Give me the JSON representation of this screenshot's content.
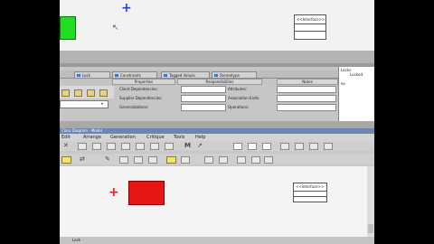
{
  "top_diagram": {
    "interface_label": "<<Interface>>",
    "plus_glyph": "+",
    "cursor_glyph": "↖"
  },
  "property_tabs": {
    "tabs": [
      "Lock",
      "Constraints",
      "Tagged Values",
      "Stereotype"
    ]
  },
  "property_subtabs": [
    "Properties",
    "Responsibilities",
    "Notes"
  ],
  "properties": {
    "left_labels": [
      "Client Dependencies:",
      "Supplier Dependencies:",
      "Generalizations:"
    ],
    "right_labels": [
      "Attributes:",
      "Association Ends:",
      "Operations:"
    ],
    "dropdown_glyph": "▾"
  },
  "locks_panel": {
    "header": "Locks",
    "column": "Locked",
    "item": "ex"
  },
  "lower_window": {
    "title": "Class Diagram - Model",
    "menus": [
      "Edit",
      "Arrange",
      "Generation",
      "Critique",
      "Tools",
      "Help"
    ],
    "toolbar_glyphs": [
      "✕",
      "⇄",
      "✎",
      "M",
      "↗"
    ],
    "status_text": "Lock"
  },
  "bottom_diagram": {
    "interface_label": "<<Interface>>",
    "plus_glyph": "+"
  },
  "colors": {
    "green_block": "#22dd22",
    "red_block": "#e81515",
    "blue_plus": "#2244dd",
    "red_plus": "#dd2222"
  }
}
